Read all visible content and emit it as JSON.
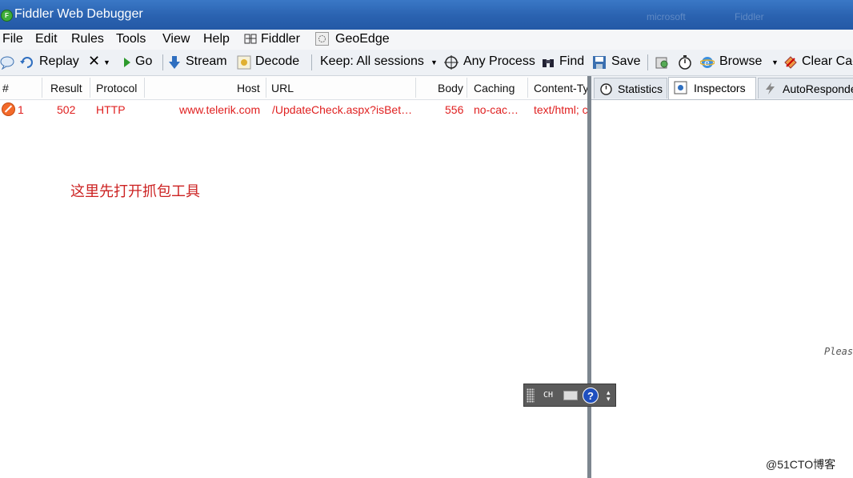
{
  "window": {
    "title": "Fiddler Web Debugger",
    "ghost_text_1": "microsoft",
    "ghost_text_2": "Fiddler"
  },
  "menu": {
    "items": [
      "File",
      "Edit",
      "Rules",
      "Tools",
      "View",
      "Help"
    ],
    "fiddler_label": "Fiddler",
    "geoedge_label": "GeoEdge"
  },
  "toolbar": {
    "replay": "Replay",
    "remove": "✕",
    "go": "Go",
    "stream": "Stream",
    "decode": "Decode",
    "keep": "Keep: All sessions",
    "process": "Any Process",
    "find": "Find",
    "save": "Save",
    "browse": "Browse",
    "clear_cache": "Clear Cac"
  },
  "sessions": {
    "columns": [
      "#",
      "Result",
      "Protocol",
      "Host",
      "URL",
      "Body",
      "Caching",
      "Content-Ty"
    ],
    "rows": [
      {
        "num": "1",
        "result": "502",
        "protocol": "HTTP",
        "host": "www.telerik.com",
        "url": "/UpdateCheck.aspx?isBet…",
        "body": "556",
        "caching": "no-cac…",
        "content_type": "text/html; c"
      }
    ]
  },
  "annotation": "这里先打开抓包工具",
  "right_panel": {
    "tabs": [
      "Statistics",
      "Inspectors",
      "AutoResponde"
    ],
    "active_tab": "Inspectors",
    "partial_text": "Pleas"
  },
  "ime_bar": {
    "label": "CH"
  },
  "watermark": "@51CTO博客",
  "colors": {
    "error_text": "#e02020",
    "annotation": "#cc2222",
    "titlebar": "#2a62b0"
  }
}
